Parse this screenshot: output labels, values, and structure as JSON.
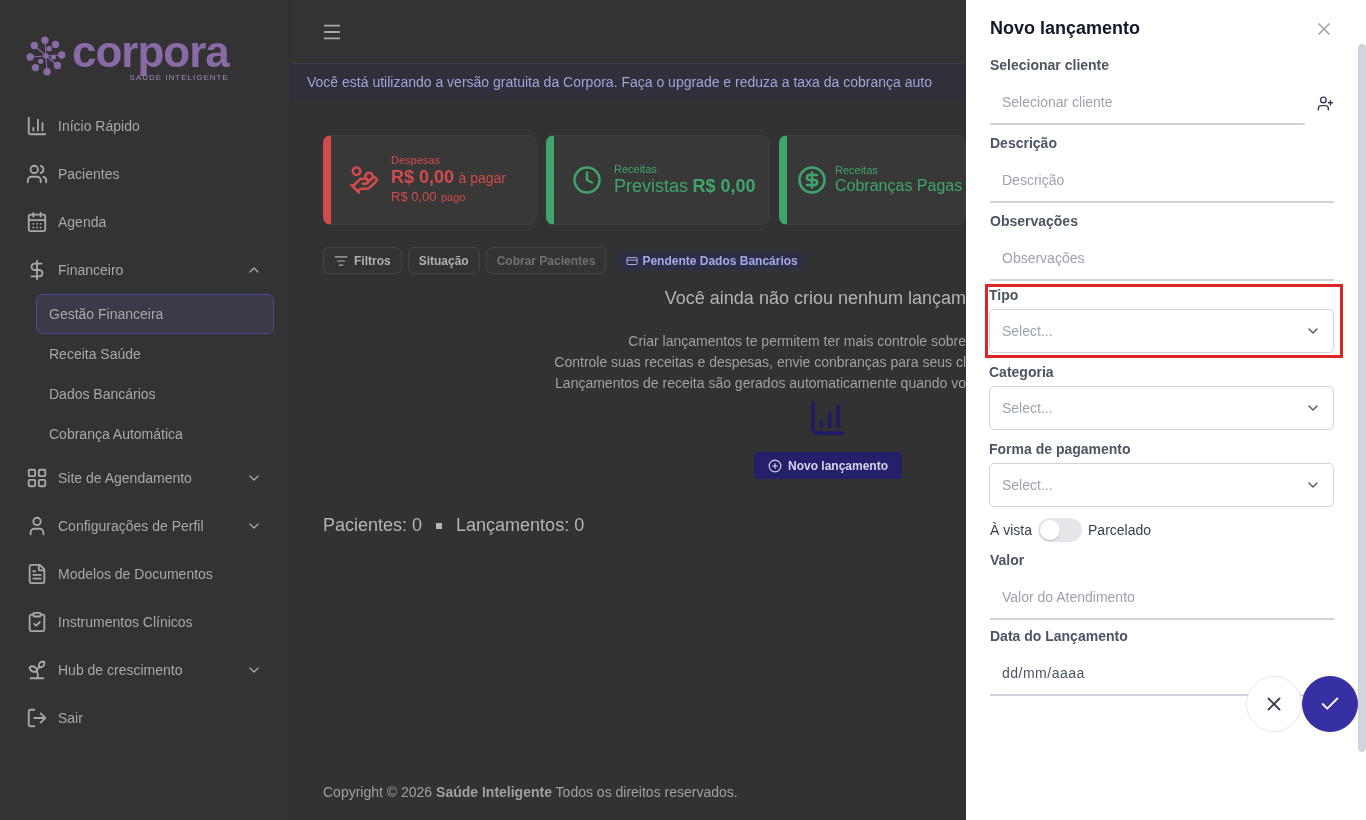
{
  "sidebar": {
    "logo": {
      "name": "corpora",
      "tagline": "SAÚDE INTELIGENTE"
    },
    "items": [
      {
        "label": "Início Rápido",
        "expandable": false
      },
      {
        "label": "Pacientes",
        "expandable": false
      },
      {
        "label": "Agenda",
        "expandable": false
      },
      {
        "label": "Financeiro",
        "expandable": true,
        "expanded": true,
        "children": [
          {
            "label": "Gestão Financeira",
            "selected": true
          },
          {
            "label": "Receita Saúde",
            "selected": false
          },
          {
            "label": "Dados Bancários",
            "selected": false
          },
          {
            "label": "Cobrança Automática",
            "selected": false
          }
        ]
      },
      {
        "label": "Site de Agendamento",
        "expandable": true,
        "expanded": false
      },
      {
        "label": "Configurações de Perfil",
        "expandable": true,
        "expanded": false
      },
      {
        "label": "Modelos de Documentos",
        "expandable": false
      },
      {
        "label": "Instrumentos Clínicos",
        "expandable": false
      },
      {
        "label": "Hub de crescimento",
        "expandable": true,
        "expanded": false
      },
      {
        "label": "Sair",
        "expandable": false
      }
    ]
  },
  "banner": "Você está utilizando a versão gratuita da Corpora. Faça o upgrade e reduza a taxa da cobrança auto",
  "cards": [
    {
      "kind": "expense",
      "color": "#d14b4b",
      "label": "Despesas",
      "amount": "R$ 0,00",
      "suffix": "à pagar",
      "sub_amount": "R$ 0,00",
      "sub_suffix": "pago"
    },
    {
      "kind": "forecast",
      "color": "#3fa56a",
      "label": "Receitas",
      "prefix": "Previstas",
      "amount": "R$ 0,00"
    },
    {
      "kind": "paid",
      "color": "#3fa56a",
      "label": "Receitas",
      "prefix": "Cobranças Pagas"
    }
  ],
  "toolbar": [
    {
      "kind": "filter",
      "label": "Filtros",
      "disabled": false
    },
    {
      "kind": "button",
      "label": "Situação",
      "disabled": false
    },
    {
      "kind": "button",
      "label": "Cobrar Pacientes",
      "disabled": true
    },
    {
      "kind": "badge",
      "label": "Pendente Dados Bancários",
      "disabled": false
    }
  ],
  "empty_state": {
    "title": "Você ainda não criou nenhum lançam",
    "lines": [
      "Criar lançamentos te permitem ter mais controle sobre",
      "Controle suas receitas e despesas, envie conbranças para seus cl",
      "Lançamentos de receita são gerados automaticamente quando vo"
    ],
    "button": "Novo lançamento"
  },
  "stats": [
    "Pacientes: 0",
    "Lançamentos: 0"
  ],
  "footer": "Copyright © 2026 **Saúde Inteligente** Todos os direitos reservados.",
  "drawer": {
    "title": "Novo lançamento",
    "fields": [
      {
        "kind": "client",
        "label": "Selecionar cliente",
        "placeholder": "Selecionar cliente"
      },
      {
        "kind": "text",
        "label": "Descrição",
        "placeholder": "Descrição"
      },
      {
        "kind": "text",
        "label": "Observações",
        "placeholder": "Observações"
      },
      {
        "kind": "select",
        "label": "Tipo",
        "placeholder": "Select...",
        "highlighted": true
      },
      {
        "kind": "select",
        "label": "Categoria",
        "placeholder": "Select...",
        "highlighted": false
      },
      {
        "kind": "select",
        "label": "Forma de pagamento",
        "placeholder": "Select...",
        "highlighted": false
      },
      {
        "kind": "switch",
        "left": "À vista",
        "right": "Parcelado",
        "on": false
      },
      {
        "kind": "text",
        "label": "Valor",
        "placeholder": "Valor do Atendimento"
      },
      {
        "kind": "date",
        "label": "Data do Lançamento",
        "placeholder": "dd/mm/aaaa"
      }
    ]
  }
}
